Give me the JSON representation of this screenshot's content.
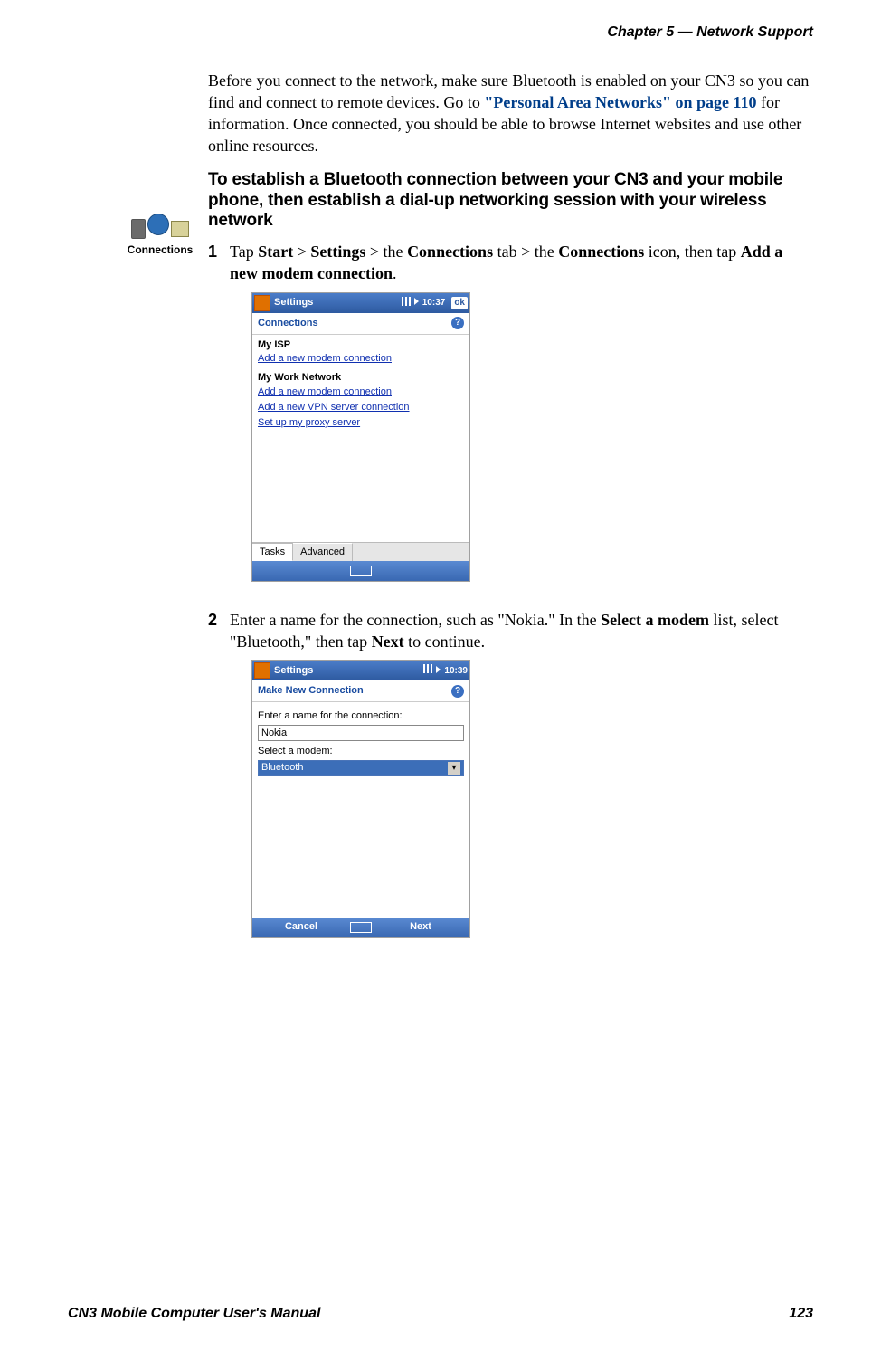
{
  "header": {
    "chapter": "Chapter 5 —  Network Support"
  },
  "intro": {
    "text_before_link": "Before you connect to the network, make sure Bluetooth is enabled on your CN3 so you can find and connect to remote devices. Go to ",
    "link_text": "\"Personal Area Networks\" on page 110",
    "text_after_link": " for information. Once connected, you should be able to browse Internet websites and use other online resources."
  },
  "heading": "To establish a Bluetooth connection between your CN3 and your mobile phone, then establish a dial-up networking session with your wireless network",
  "connections_icon_label": "Connections",
  "step1": {
    "num": "1",
    "t1": "Tap ",
    "b1": "Start",
    "t2": " > ",
    "b2": "Settings",
    "t3": " > the ",
    "b3": "Connections",
    "t4": " tab > the ",
    "b4": "Connections",
    "t5": " icon, then tap ",
    "b5": "Add a new modem connection",
    "t6": "."
  },
  "mockup1": {
    "title": "Settings",
    "time": "10:37",
    "ok": "ok",
    "screen_title": "Connections",
    "section1_label": "My ISP",
    "section1_link1": "Add a new modem connection",
    "section2_label": "My Work Network",
    "section2_link1": "Add a new modem connection",
    "section2_link2": "Add a new VPN server connection",
    "section2_link3": "Set up my proxy server",
    "tab1": "Tasks",
    "tab2": "Advanced"
  },
  "step2": {
    "num": "2",
    "t1": "Enter a name for the connection, such as \"Nokia.\" In the ",
    "b1": "Select a modem",
    "t2": " list, select \"Bluetooth,\" then tap ",
    "b2": "Next",
    "t3": " to continue."
  },
  "mockup2": {
    "title": "Settings",
    "time": "10:39",
    "screen_title": "Make New Connection",
    "label1": "Enter a name for the connection:",
    "input_value": "Nokia",
    "label2": "Select a modem:",
    "select_value": "Bluetooth",
    "cancel": "Cancel",
    "next": "Next"
  },
  "footer": {
    "left": "CN3 Mobile Computer User's Manual",
    "right": "123"
  }
}
